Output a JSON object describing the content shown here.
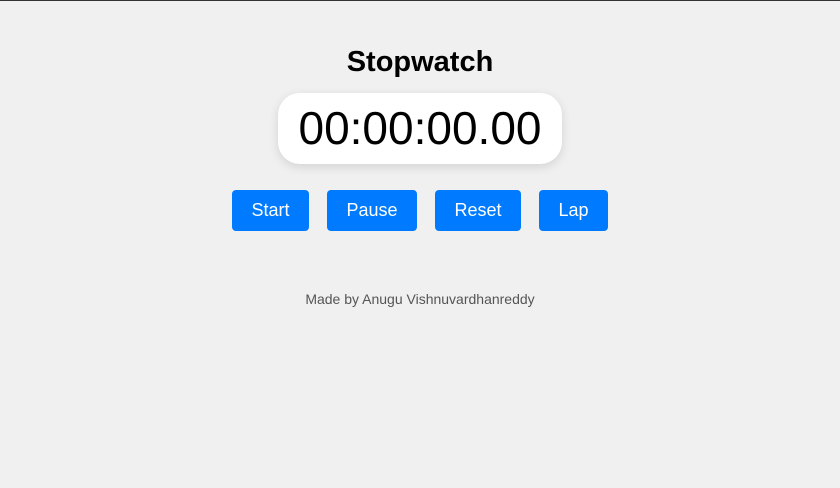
{
  "title": "Stopwatch",
  "display": {
    "time": "00:00:00.00"
  },
  "controls": {
    "start_label": "Start",
    "pause_label": "Pause",
    "reset_label": "Reset",
    "lap_label": "Lap"
  },
  "footer": {
    "text": "Made by Anugu Vishnuvardhanreddy"
  },
  "colors": {
    "background": "#f0f0f0",
    "button": "#007bff",
    "display_bg": "#ffffff"
  }
}
